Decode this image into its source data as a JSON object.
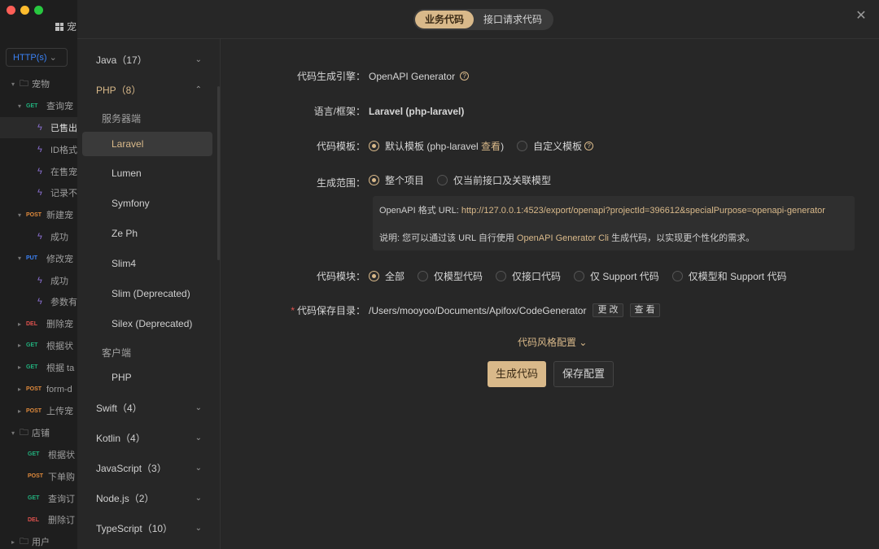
{
  "bg": {
    "title": "宠",
    "method": "HTTP(s)",
    "tree": [
      {
        "caret": "▾",
        "kind": "folder",
        "label": "宠物"
      },
      {
        "caret": "▾",
        "method": "GET",
        "mclass": "m-get",
        "label": "查询宠"
      },
      {
        "kind": "case",
        "label": "已售出",
        "sel": true
      },
      {
        "kind": "case",
        "label": "ID格式"
      },
      {
        "kind": "case",
        "label": "在售宠"
      },
      {
        "kind": "case",
        "label": "记录不"
      },
      {
        "caret": "▾",
        "method": "POST",
        "mclass": "m-post",
        "label": "新建宠"
      },
      {
        "kind": "case",
        "label": "成功"
      },
      {
        "caret": "▾",
        "method": "PUT",
        "mclass": "m-put",
        "label": "修改宠"
      },
      {
        "kind": "case",
        "label": "成功"
      },
      {
        "kind": "case",
        "label": "参数有"
      },
      {
        "caret": "▸",
        "method": "DEL",
        "mclass": "m-del",
        "label": "删除宠"
      },
      {
        "caret": "▸",
        "method": "GET",
        "mclass": "m-get",
        "label": "根据状"
      },
      {
        "caret": "▸",
        "method": "GET",
        "mclass": "m-get",
        "label": "根据 ta"
      },
      {
        "caret": "▸",
        "method": "POST",
        "mclass": "m-post",
        "label": "form-d"
      },
      {
        "caret": "▸",
        "method": "POST",
        "mclass": "m-post",
        "label": "上传宠"
      },
      {
        "caret": "▾",
        "kind": "folder",
        "label": "店铺"
      },
      {
        "method": "GET",
        "mclass": "m-get",
        "label": "根据状"
      },
      {
        "method": "POST",
        "mclass": "m-post",
        "label": "下单购"
      },
      {
        "method": "GET",
        "mclass": "m-get",
        "label": "查询订"
      },
      {
        "method": "DEL",
        "mclass": "m-del",
        "label": "删除订"
      },
      {
        "caret": "▸",
        "kind": "folder",
        "label": "用户"
      }
    ]
  },
  "tabs": {
    "business": "业务代码",
    "request": "接口请求代码"
  },
  "sidebar": {
    "java": "Java（17）",
    "php": "PHP（8）",
    "server_group": "服务器端",
    "frameworks": [
      "Laravel",
      "Lumen",
      "Symfony",
      "Ze Ph",
      "Slim4",
      "Slim (Deprecated)",
      "Silex (Deprecated)"
    ],
    "client_group": "客户端",
    "client_frameworks": [
      "PHP"
    ],
    "others": [
      "Swift（4）",
      "Kotlin（4）",
      "JavaScript（3）",
      "Node.js（2）",
      "TypeScript（10）"
    ]
  },
  "form": {
    "engine_label": "代码生成引擎：",
    "engine_value": "OpenAPI Generator",
    "lang_label": "语言/框架：",
    "lang_value": "Laravel (php-laravel)",
    "template_label": "代码模板：",
    "template_default": "默认模板 (php-laravel ",
    "template_view": "查看",
    "template_default_end": ")",
    "template_custom": "自定义模板",
    "scope_label": "生成范围：",
    "scope_all": "整个项目",
    "scope_current": "仅当前接口及关联模型",
    "info_url_label": "OpenAPI 格式 URL: ",
    "info_url": "http://127.0.0.1:4523/export/openapi?projectId=396612&specialPurpose=openapi-generator",
    "info_desc_pre": "说明: 您可以通过该 URL 自行使用 ",
    "info_desc_link": "OpenAPI Generator Cli",
    "info_desc_post": " 生成代码，以实现更个性化的需求。",
    "module_label": "代码模块：",
    "modules": [
      "全部",
      "仅模型代码",
      "仅接口代码",
      "仅 Support 代码",
      "仅模型和 Support 代码"
    ],
    "dir_label": "代码保存目录：",
    "dir_value": "/Users/mooyoo/Documents/Apifox/CodeGenerator",
    "dir_change": "更 改",
    "dir_view": "查 看",
    "style_toggle": "代码风格配置",
    "generate": "生成代码",
    "save": "保存配置"
  }
}
